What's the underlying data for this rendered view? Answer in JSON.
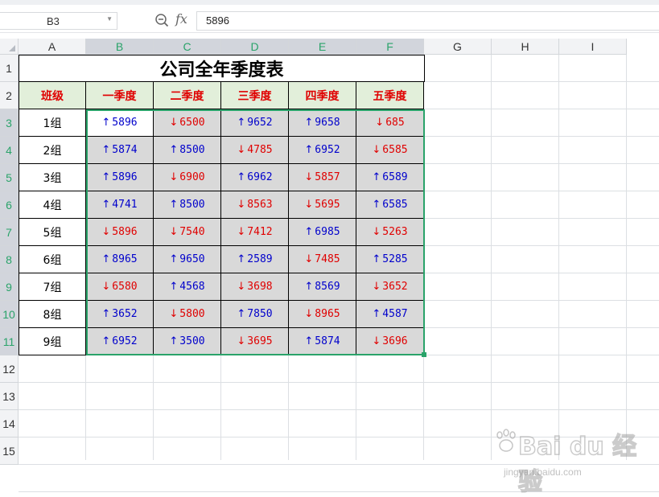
{
  "formula_bar": {
    "name_box": "B3",
    "fx_label": "fx",
    "value": "5896"
  },
  "columns": [
    "A",
    "B",
    "C",
    "D",
    "E",
    "F",
    "G",
    "H",
    "I"
  ],
  "rows": [
    "1",
    "2",
    "3",
    "4",
    "5",
    "6",
    "7",
    "8",
    "9",
    "10",
    "11",
    "12",
    "13",
    "14",
    "15"
  ],
  "sheet": {
    "title": "公司全年季度表",
    "header": [
      "班级",
      "一季度",
      "二季度",
      "三季度",
      "四季度",
      "五季度"
    ],
    "data": [
      {
        "group": "1组",
        "values": [
          "5896",
          "6500",
          "9652",
          "9658",
          "685"
        ],
        "dirs": [
          "up",
          "down",
          "up",
          "up",
          "down"
        ]
      },
      {
        "group": "2组",
        "values": [
          "5874",
          "8500",
          "4785",
          "6952",
          "6585"
        ],
        "dirs": [
          "up",
          "up",
          "down",
          "up",
          "down"
        ]
      },
      {
        "group": "3组",
        "values": [
          "5896",
          "6900",
          "6962",
          "5857",
          "6589"
        ],
        "dirs": [
          "up",
          "down",
          "up",
          "down",
          "up"
        ]
      },
      {
        "group": "4组",
        "values": [
          "4741",
          "8500",
          "8563",
          "5695",
          "6585"
        ],
        "dirs": [
          "up",
          "up",
          "down",
          "down",
          "up"
        ]
      },
      {
        "group": "5组",
        "values": [
          "5896",
          "7540",
          "7412",
          "6985",
          "5263"
        ],
        "dirs": [
          "down",
          "down",
          "down",
          "up",
          "down"
        ]
      },
      {
        "group": "6组",
        "values": [
          "8965",
          "9650",
          "2589",
          "7485",
          "5285"
        ],
        "dirs": [
          "up",
          "up",
          "up",
          "down",
          "up"
        ]
      },
      {
        "group": "7组",
        "values": [
          "6580",
          "4568",
          "3698",
          "8569",
          "3652"
        ],
        "dirs": [
          "down",
          "up",
          "down",
          "up",
          "down"
        ]
      },
      {
        "group": "8组",
        "values": [
          "3652",
          "5800",
          "7850",
          "8965",
          "4587"
        ],
        "dirs": [
          "up",
          "down",
          "up",
          "down",
          "up"
        ]
      },
      {
        "group": "9组",
        "values": [
          "6952",
          "3500",
          "3695",
          "5874",
          "3696"
        ],
        "dirs": [
          "up",
          "up",
          "down",
          "up",
          "down"
        ]
      }
    ]
  },
  "arrows": {
    "up": "↑",
    "down": "↓"
  },
  "colors": {
    "up": "#0000cc",
    "down": "#e00000",
    "header_fill": "#e2efda",
    "data_fill": "#d9d9d9",
    "selection": "#2aa36a"
  },
  "watermark": {
    "brand": "Bai du 经验",
    "site": "jingyan.baidu.com"
  }
}
